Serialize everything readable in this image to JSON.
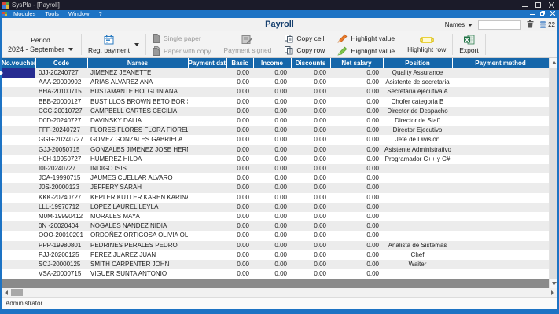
{
  "window": {
    "title": "SysPla - [Payroll]",
    "menu": [
      "Modules",
      "Tools",
      "Window",
      "?"
    ],
    "page_title": "Payroll",
    "status": "Administrator"
  },
  "toolbar": {
    "period_label": "Period",
    "period_value": "2024 - September",
    "reg_payment": "Reg. payment",
    "single_paper": "Single paper",
    "paper_with_copy": "Paper with copy",
    "payment_signed": "Payment signed",
    "copy_cell": "Copy cell",
    "copy_row": "Copy row",
    "highlight_value_1": "Highlight value",
    "highlight_value_2": "Highlight value",
    "highlight_row": "Highlight row",
    "export": "Export"
  },
  "filter": {
    "names_label": "Names",
    "search_value": "",
    "record_count": "22"
  },
  "table": {
    "columns": [
      "No.voucher",
      "Code",
      "Names",
      "Payment date",
      "Basic",
      "Income",
      "Discounts",
      "Net salary",
      "Position",
      "Payment method"
    ],
    "rows": [
      {
        "voucher": "",
        "code": "0JJ-20240727",
        "name": "JIMENEZ JEANETTE",
        "payment_date": "",
        "basic": "0.00",
        "income": "0.00",
        "discounts": "0.00",
        "net_salary": "0.00",
        "position": "Quality Assurance",
        "payment_method": ""
      },
      {
        "voucher": "",
        "code": "AAA-20000902",
        "name": "ARIAS ALVAREZ ANA",
        "payment_date": "",
        "basic": "0.00",
        "income": "0.00",
        "discounts": "0.00",
        "net_salary": "0.00",
        "position": "Asistente de secretaria",
        "payment_method": ""
      },
      {
        "voucher": "",
        "code": "BHA-20100715",
        "name": "BUSTAMANTE HOLGUIN ANA",
        "payment_date": "",
        "basic": "0.00",
        "income": "0.00",
        "discounts": "0.00",
        "net_salary": "0.00",
        "position": "Secretaria ejecutiva A",
        "payment_method": ""
      },
      {
        "voucher": "",
        "code": "BBB-20000127",
        "name": "BUSTILLOS BROWN BETO BORIS",
        "payment_date": "",
        "basic": "0.00",
        "income": "0.00",
        "discounts": "0.00",
        "net_salary": "0.00",
        "position": "Chofer categoria B",
        "payment_method": ""
      },
      {
        "voucher": "",
        "code": "CCC-20010727",
        "name": "CAMPBELL CARTES CECILIA",
        "payment_date": "",
        "basic": "0.00",
        "income": "0.00",
        "discounts": "0.00",
        "net_salary": "0.00",
        "position": "Director de Despacho",
        "payment_method": ""
      },
      {
        "voucher": "",
        "code": "D0D-20240727",
        "name": "DAVINSKY  DALIA",
        "payment_date": "",
        "basic": "0.00",
        "income": "0.00",
        "discounts": "0.00",
        "net_salary": "0.00",
        "position": "Director de Staff",
        "payment_method": ""
      },
      {
        "voucher": "",
        "code": "FFF-20240727",
        "name": "FLORES FLORES FLORA FIORELLA",
        "payment_date": "",
        "basic": "0.00",
        "income": "0.00",
        "discounts": "0.00",
        "net_salary": "0.00",
        "position": "Director Ejecutivo",
        "payment_method": ""
      },
      {
        "voucher": "",
        "code": "GGG-20240727",
        "name": "GOMEZ GONZALES GABRIELA",
        "payment_date": "",
        "basic": "0.00",
        "income": "0.00",
        "discounts": "0.00",
        "net_salary": "0.00",
        "position": "Jefe de Division",
        "payment_method": ""
      },
      {
        "voucher": "",
        "code": "GJJ-20050715",
        "name": "GONZALES JIMENEZ JOSE HERNANDO",
        "payment_date": "",
        "basic": "0.00",
        "income": "0.00",
        "discounts": "0.00",
        "net_salary": "0.00",
        "position": "Asistente Administrativo II",
        "payment_method": ""
      },
      {
        "voucher": "",
        "code": "H0H-19950727",
        "name": "HUMEREZ  HILDA",
        "payment_date": "",
        "basic": "0.00",
        "income": "0.00",
        "discounts": "0.00",
        "net_salary": "0.00",
        "position": "Programador C++ y C#",
        "payment_method": ""
      },
      {
        "voucher": "",
        "code": "I0I-20240727",
        "name": "INDIGO  ISIS",
        "payment_date": "",
        "basic": "0.00",
        "income": "0.00",
        "discounts": "0.00",
        "net_salary": "0.00",
        "position": "",
        "payment_method": ""
      },
      {
        "voucher": "",
        "code": "JCA-19990715",
        "name": "JAUMES CUELLAR ALVARO",
        "payment_date": "",
        "basic": "0.00",
        "income": "0.00",
        "discounts": "0.00",
        "net_salary": "0.00",
        "position": "",
        "payment_method": ""
      },
      {
        "voucher": "",
        "code": "J0S-20000123",
        "name": "JEFFERY  SARAH",
        "payment_date": "",
        "basic": "0.00",
        "income": "0.00",
        "discounts": "0.00",
        "net_salary": "0.00",
        "position": "",
        "payment_method": ""
      },
      {
        "voucher": "",
        "code": "KKK-20240727",
        "name": "KEPLER KUTLER KAREN KARINA",
        "payment_date": "",
        "basic": "0.00",
        "income": "0.00",
        "discounts": "0.00",
        "net_salary": "0.00",
        "position": "",
        "payment_method": ""
      },
      {
        "voucher": "",
        "code": "LLL-19970712",
        "name": "LOPEZ LAUREL LEYLA",
        "payment_date": "",
        "basic": "0.00",
        "income": "0.00",
        "discounts": "0.00",
        "net_salary": "0.00",
        "position": "",
        "payment_method": ""
      },
      {
        "voucher": "",
        "code": "M0M-19990412",
        "name": "MORALES  MAYA",
        "payment_date": "",
        "basic": "0.00",
        "income": "0.00",
        "discounts": "0.00",
        "net_salary": "0.00",
        "position": "",
        "payment_method": ""
      },
      {
        "voucher": "",
        "code": "0N -20020404",
        "name": "NOGALES NANDEZ  NIDIA",
        "payment_date": "",
        "basic": "0.00",
        "income": "0.00",
        "discounts": "0.00",
        "net_salary": "0.00",
        "position": "",
        "payment_method": ""
      },
      {
        "voucher": "",
        "code": "OOO-20010201",
        "name": "ORDOÑEZ ORTIGOSA OLIVIA OLI",
        "payment_date": "",
        "basic": "0.00",
        "income": "0.00",
        "discounts": "0.00",
        "net_salary": "0.00",
        "position": "",
        "payment_method": ""
      },
      {
        "voucher": "",
        "code": "PPP-19980801",
        "name": "PEDRINES PERALES PEDRO",
        "payment_date": "",
        "basic": "0.00",
        "income": "0.00",
        "discounts": "0.00",
        "net_salary": "0.00",
        "position": "Analista de Sistemas",
        "payment_method": ""
      },
      {
        "voucher": "",
        "code": "PJJ-20200125",
        "name": "PEREZ JUAREZ JUAN",
        "payment_date": "",
        "basic": "0.00",
        "income": "0.00",
        "discounts": "0.00",
        "net_salary": "0.00",
        "position": "Chef",
        "payment_method": ""
      },
      {
        "voucher": "",
        "code": "SCJ-20000125",
        "name": "SMITH CARPENTER JOHN",
        "payment_date": "",
        "basic": "0.00",
        "income": "0.00",
        "discounts": "0.00",
        "net_salary": "0.00",
        "position": "Waiter",
        "payment_method": ""
      },
      {
        "voucher": "",
        "code": "VSA-20000715",
        "name": "VIGUER SUNTA ANTONIO",
        "payment_date": "",
        "basic": "0.00",
        "income": "0.00",
        "discounts": "0.00",
        "net_salary": "0.00",
        "position": "",
        "payment_method": ""
      }
    ]
  },
  "colors": {
    "frame_blue": "#1d73c4",
    "grid_header_blue": "#1566aa",
    "selected_cell_navy": "#272c91",
    "highlight_orange": "#e8792a",
    "highlight_green": "#7cc24a",
    "highlight_yellow": "#e8c800",
    "excel_green": "#217346"
  }
}
